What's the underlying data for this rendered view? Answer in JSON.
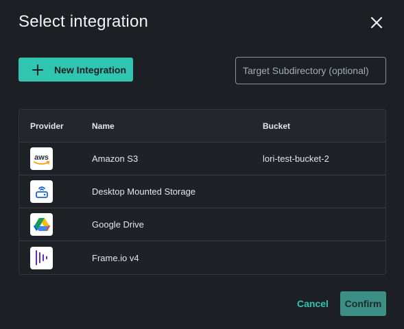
{
  "dialog": {
    "title": "Select integration",
    "close_icon": "close-icon"
  },
  "toolbar": {
    "new_integration_label": "New Integration",
    "subdir_placeholder": "Target Subdirectory (optional)",
    "subdir_value": ""
  },
  "table": {
    "headers": {
      "provider": "Provider",
      "name": "Name",
      "bucket": "Bucket"
    },
    "rows": [
      {
        "icon": "aws-icon",
        "name": "Amazon S3",
        "bucket": "lori-test-bucket-2"
      },
      {
        "icon": "storage-drive-icon",
        "name": "Desktop Mounted Storage",
        "bucket": ""
      },
      {
        "icon": "google-drive-icon",
        "name": "Google Drive",
        "bucket": ""
      },
      {
        "icon": "frameio-icon",
        "name": "Frame.io v4",
        "bucket": ""
      }
    ]
  },
  "footer": {
    "cancel_label": "Cancel",
    "confirm_label": "Confirm"
  },
  "colors": {
    "background": "#1c1f24",
    "accent": "#2fc5b0",
    "confirm_disabled": "#3b8f84",
    "table_header": "#23272d"
  }
}
